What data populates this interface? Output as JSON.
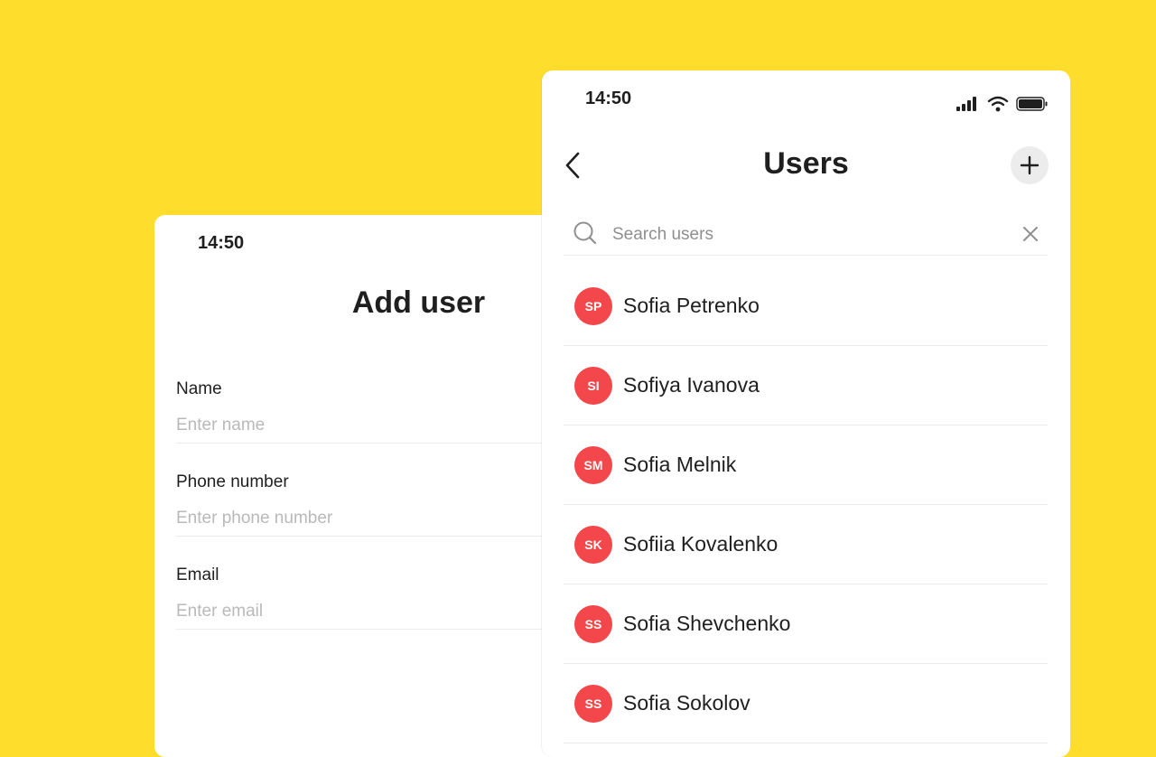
{
  "add_user": {
    "status_time": "14:50",
    "title": "Add user",
    "fields": [
      {
        "label": "Name",
        "placeholder": "Enter name"
      },
      {
        "label": "Phone number",
        "placeholder": "Enter phone number"
      },
      {
        "label": "Email",
        "placeholder": "Enter email"
      }
    ]
  },
  "users": {
    "status_time": "14:50",
    "title": "Users",
    "search": {
      "placeholder": "Search users"
    },
    "items": [
      {
        "initials": "SP",
        "name": "Sofia Petrenko"
      },
      {
        "initials": "SI",
        "name": "Sofiya Ivanova"
      },
      {
        "initials": "SM",
        "name": "Sofia Melnik"
      },
      {
        "initials": "SK",
        "name": "Sofiia Kovalenko"
      },
      {
        "initials": "SS",
        "name": "Sofia Shevchenko"
      },
      {
        "initials": "SS",
        "name": "Sofia Sokolov"
      }
    ]
  },
  "colors": {
    "background": "#FFDD2D",
    "avatar": "#F4474B",
    "card": "#FFFFFF"
  },
  "icons": {
    "back": "chevron-left-icon",
    "add": "plus-icon",
    "search": "search-icon",
    "clear": "close-icon",
    "signal": "signal-icon",
    "wifi": "wifi-icon",
    "battery": "battery-icon"
  }
}
